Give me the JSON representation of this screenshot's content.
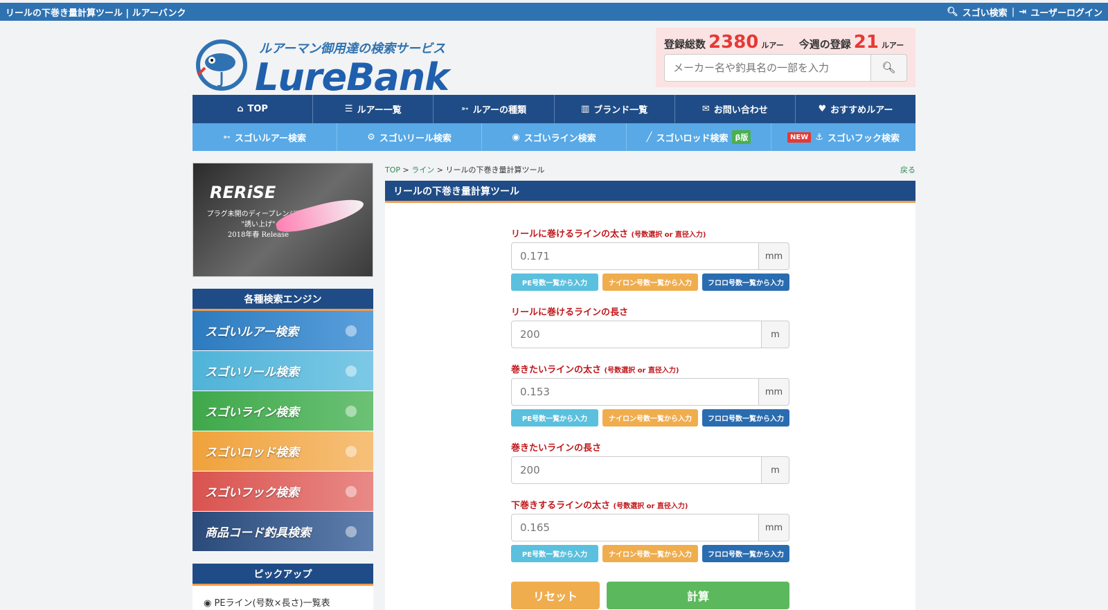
{
  "topbar": {
    "title": "リールの下巻き量計算ツール | ルアーバンク",
    "search_link": "スゴい検索",
    "login_link": "ユーザーログイン",
    "separator": "|"
  },
  "header": {
    "tagline": "ルアーマン御用達の検索サービス",
    "logo": "LureBank"
  },
  "stats": {
    "total_label": "登録総数",
    "total_value": "2380",
    "total_unit": "ルアー",
    "week_label": "今週の登録",
    "week_value": "21",
    "week_unit": "ルアー"
  },
  "search": {
    "placeholder": "メーカー名や釣具名の一部を入力"
  },
  "nav1": [
    {
      "label": "TOP",
      "icon": "home-icon"
    },
    {
      "label": "ルアー一覧",
      "icon": "list-icon"
    },
    {
      "label": "ルアーの種類",
      "icon": "fish-icon"
    },
    {
      "label": "ブランド一覧",
      "icon": "building-icon"
    },
    {
      "label": "お問い合わせ",
      "icon": "mail-icon"
    },
    {
      "label": "おすすめルアー",
      "icon": "heart-icon"
    }
  ],
  "nav2": [
    {
      "label": "スゴいルアー検索",
      "icon": "lure-icon"
    },
    {
      "label": "スゴいリール検索",
      "icon": "reel-icon"
    },
    {
      "label": "スゴいライン検索",
      "icon": "line-icon"
    },
    {
      "label": "スゴいロッド検索",
      "icon": "rod-icon",
      "badge": "β版"
    },
    {
      "label": "スゴいフック検索",
      "icon": "hook-icon",
      "badge_new": "NEW"
    }
  ],
  "sidebar": {
    "banner_brand": "RERiSE",
    "banner_sub1": "プラグ未開のディープレンジ攻略",
    "banner_sub2": "\"誘い上げ\"",
    "banner_sub3": "2018年春 Release",
    "engines_title": "各種検索エンジン",
    "engines": [
      {
        "label": "スゴいルアー検索",
        "color": "#2c7bbf"
      },
      {
        "label": "スゴいリール検索",
        "color": "#4fb3d8"
      },
      {
        "label": "スゴいライン検索",
        "color": "#3fa84a"
      },
      {
        "label": "スゴいロッド検索",
        "color": "#f0a23b"
      },
      {
        "label": "スゴいフック検索",
        "color": "#d9534f"
      },
      {
        "label": "商品コード釣具検索",
        "color": "#2a4a7a"
      }
    ],
    "pickup_title": "ピックアップ",
    "pickup_items": [
      "PEライン(号数×長さ)一覧表"
    ]
  },
  "breadcrumb": {
    "top": "TOP",
    "sep": ">",
    "line": "ライン",
    "current": "リールの下巻き量計算ツール",
    "back": "戻る"
  },
  "page_title": "リールの下巻き量計算ツール",
  "form": {
    "reel_thickness_label": "リールに巻けるラインの太さ",
    "reel_thickness_note": "(号数選択 or 直径入力)",
    "reel_thickness_placeholder": "0.171",
    "reel_thickness_unit": "mm",
    "reel_length_label": "リールに巻けるラインの長さ",
    "reel_length_placeholder": "200",
    "reel_length_unit": "m",
    "want_thickness_label": "巻きたいラインの太さ",
    "want_thickness_note": "(号数選択 or 直径入力)",
    "want_thickness_placeholder": "0.153",
    "want_thickness_unit": "mm",
    "want_length_label": "巻きたいラインの長さ",
    "want_length_placeholder": "200",
    "want_length_unit": "m",
    "under_thickness_label": "下巻きするラインの太さ",
    "under_thickness_note": "(号数選択 or 直径入力)",
    "under_thickness_placeholder": "0.165",
    "under_thickness_unit": "mm",
    "pe_button": "PE号数一覧から入力",
    "nylon_button": "ナイロン号数一覧から入力",
    "fluoro_button": "フロロ号数一覧から入力",
    "reset_button": "リセット",
    "calc_button": "計算"
  },
  "colors": {
    "primary_blue": "#1f4c86",
    "topbar_blue": "#2f72b2",
    "sub_nav": "#58a9e6",
    "accent_orange": "#f39c4a",
    "label_red": "#c0171b",
    "count_red": "#e53935"
  }
}
